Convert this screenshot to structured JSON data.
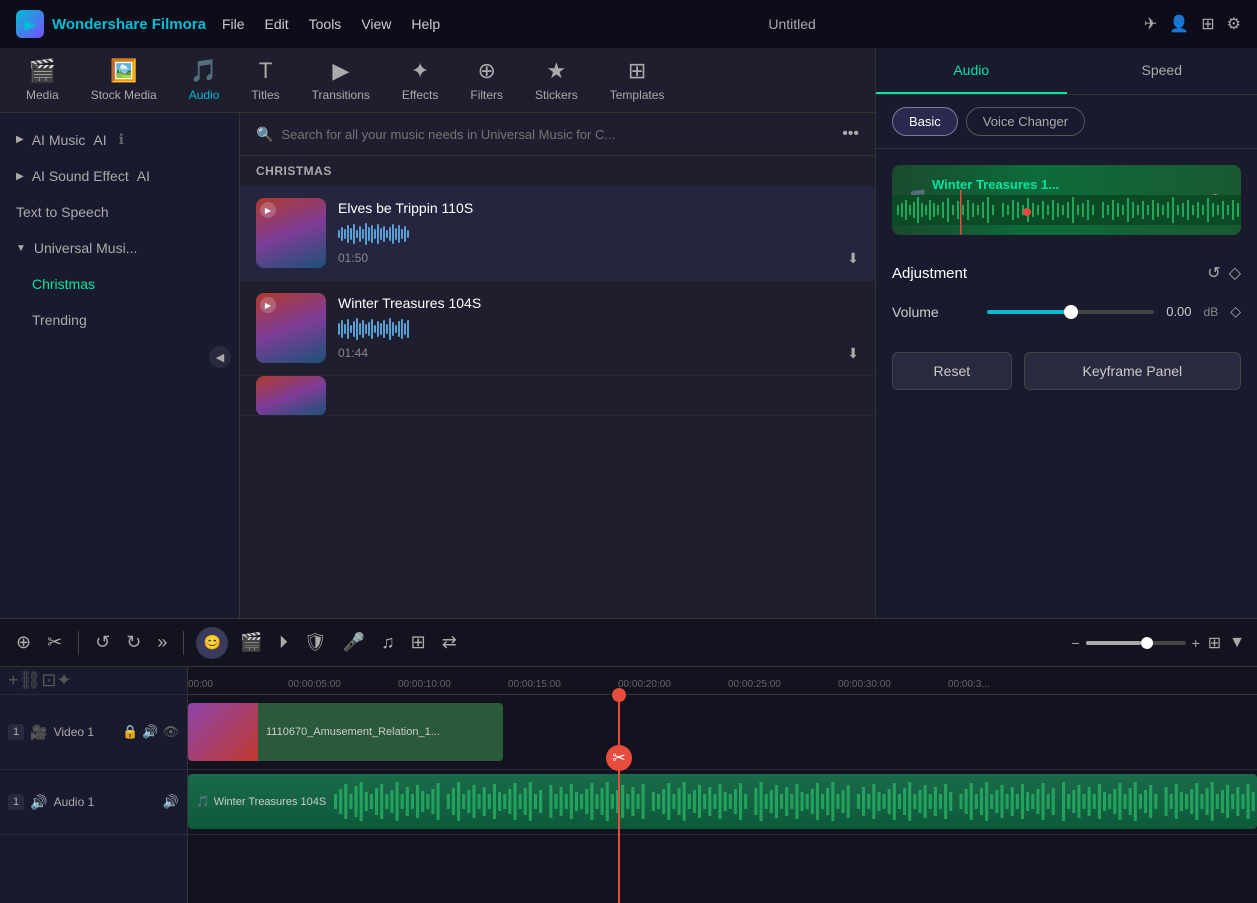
{
  "app": {
    "name": "Wondershare Filmora",
    "title": "Untitled"
  },
  "menu": {
    "items": [
      "File",
      "Edit",
      "Tools",
      "View",
      "Help"
    ]
  },
  "toolbar": {
    "items": [
      {
        "id": "media",
        "label": "Media",
        "icon": "🎬"
      },
      {
        "id": "stock-media",
        "label": "Stock Media",
        "icon": "🖼️"
      },
      {
        "id": "audio",
        "label": "Audio",
        "icon": "🎵",
        "active": true
      },
      {
        "id": "titles",
        "label": "Titles",
        "icon": "T"
      },
      {
        "id": "transitions",
        "label": "Transitions",
        "icon": "▶"
      },
      {
        "id": "effects",
        "label": "Effects",
        "icon": "✦"
      },
      {
        "id": "filters",
        "label": "Filters",
        "icon": "⊕"
      },
      {
        "id": "stickers",
        "label": "Stickers",
        "icon": "★"
      },
      {
        "id": "templates",
        "label": "Templates",
        "icon": "⊞"
      }
    ]
  },
  "sidebar": {
    "items": [
      {
        "id": "ai-music",
        "label": "AI Music",
        "badge": "AI",
        "has_info": true
      },
      {
        "id": "ai-sound",
        "label": "AI Sound Effect",
        "badge": "AI"
      },
      {
        "id": "text-to-speech",
        "label": "Text to Speech",
        "simple": true
      },
      {
        "id": "universal-music",
        "label": "Universal Musi...",
        "expanded": true
      },
      {
        "id": "christmas",
        "label": "Christmas",
        "active": true,
        "sub": true
      },
      {
        "id": "trending",
        "label": "Trending",
        "sub": true
      }
    ]
  },
  "search": {
    "placeholder": "Search for all your music needs in Universal Music for C..."
  },
  "section_label": "CHRISTMAS",
  "music_tracks": [
    {
      "id": 1,
      "title": "Elves be Trippin 110S",
      "duration": "01:50",
      "active": true
    },
    {
      "id": 2,
      "title": "Winter Treasures 104S",
      "duration": "01:44",
      "active": false
    }
  ],
  "right_panel": {
    "tabs": [
      "Audio",
      "Speed"
    ],
    "active_tab": "Audio",
    "sub_tabs": [
      "Basic",
      "Voice Changer"
    ],
    "active_sub_tab": "Basic",
    "preview_title": "Winter Treasures 1...",
    "adjustment": {
      "title": "Adjustment",
      "volume_label": "Volume",
      "volume_value": "0.00",
      "volume_unit": "dB"
    },
    "buttons": {
      "reset": "Reset",
      "keyframe": "Keyframe Panel"
    }
  },
  "timeline": {
    "toolbar_buttons": [
      "split",
      "crop",
      "undo",
      "redo",
      "more"
    ],
    "time_marks": [
      "00:00",
      "00:00:05:00",
      "00:00:10:00",
      "00:00:15:00",
      "00:00:20:00",
      "00:00:25:00",
      "00:00:30:00",
      "00:00:3..."
    ],
    "tracks": [
      {
        "id": "video-1",
        "type": "video",
        "label": "Video 1",
        "number": "1"
      },
      {
        "id": "audio-1",
        "type": "audio",
        "label": "Audio 1",
        "number": "1"
      }
    ],
    "video_clip_label": "1110670_Amusement_Relation_1...",
    "audio_clip_label": "Winter Treasures 104S"
  }
}
